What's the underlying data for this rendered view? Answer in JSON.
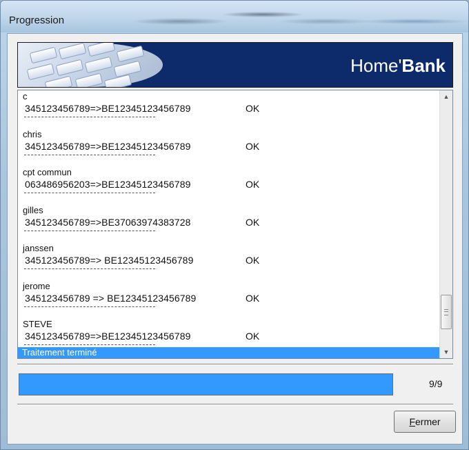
{
  "window": {
    "title": "Progression"
  },
  "banner": {
    "logo_light": "Home'",
    "logo_bold": "Bank"
  },
  "log": {
    "entries": [
      {
        "name": "c",
        "detail": "345123456789=>BE12345123456789",
        "status": "OK"
      },
      {
        "name": "chris",
        "detail": "345123456789=>BE12345123456789",
        "status": "OK"
      },
      {
        "name": "cpt commun",
        "detail": "063486956203=>BE12345123456789",
        "status": "OK"
      },
      {
        "name": "gilles",
        "detail": "345123456789=>BE37063974383728",
        "status": "OK"
      },
      {
        "name": "janssen",
        "detail": "345123456789=> BE12345123456789",
        "status": "OK"
      },
      {
        "name": "jerome",
        "detail": "345123456789 => BE12345123456789",
        "status": "OK"
      },
      {
        "name": "STEVE",
        "detail": "345123456789=>BE12345123456789",
        "status": "OK"
      }
    ],
    "selected_line": "Traitement terminé"
  },
  "progress": {
    "fraction": 1.0,
    "count_label": "9/9"
  },
  "buttons": {
    "close_accel": "F",
    "close_rest": "ermer"
  },
  "colors": {
    "accent": "#3399ff",
    "banner_bg": "#0d2a6b"
  },
  "icons": {
    "scroll_up": "scroll-up-arrow",
    "scroll_down": "scroll-down-arrow"
  }
}
